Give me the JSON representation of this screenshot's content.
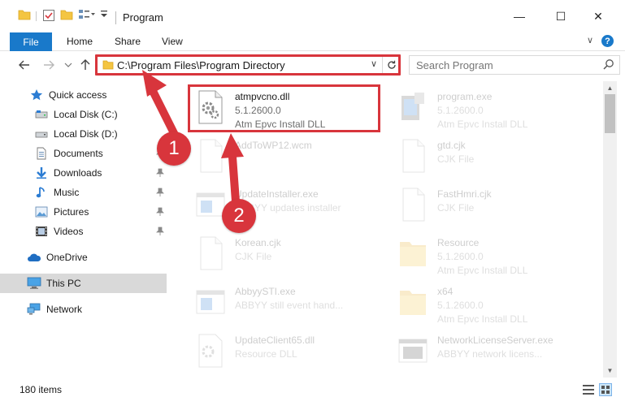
{
  "window": {
    "title": "Program",
    "minimize": "—",
    "maximize": "☐",
    "close": "✕"
  },
  "ribbon": {
    "tabs": [
      "File",
      "Home",
      "Share",
      "View"
    ],
    "collapse": "∨",
    "help": "?"
  },
  "address": {
    "path": "C:\\Program Files\\Program Directory",
    "dropdown": "∨",
    "refresh": "↻"
  },
  "search": {
    "placeholder": "Search Program"
  },
  "nav": {
    "items": [
      {
        "label": "Quick access",
        "icon": "star-icon"
      },
      {
        "label": "Local Disk (C:)",
        "icon": "drive-icon"
      },
      {
        "label": "Local Disk (D:)",
        "icon": "drive-icon"
      },
      {
        "label": "Documents",
        "icon": "documents-icon"
      },
      {
        "label": "Downloads",
        "icon": "download-icon"
      },
      {
        "label": "Music",
        "icon": "music-icon"
      },
      {
        "label": "Pictures",
        "icon": "pictures-icon"
      },
      {
        "label": "Videos",
        "icon": "videos-icon"
      },
      {
        "label": "OneDrive",
        "icon": "cloud-icon"
      },
      {
        "label": "This PC",
        "icon": "computer-icon"
      },
      {
        "label": "Network",
        "icon": "network-icon"
      }
    ]
  },
  "files": [
    {
      "name": "atmpvcno.dll",
      "line1": "5.1.2600.0",
      "line2": "Atm Epvc Install DLL"
    },
    {
      "name": "program.exe",
      "line1": "5.1.2600.0",
      "line2": "Atm Epvc Install DLL"
    },
    {
      "name": "AddToWP12.wcm",
      "line1": "",
      "line2": ""
    },
    {
      "name": "gtd.cjk",
      "line1": "CJK File",
      "line2": ""
    },
    {
      "name": "UpdateInstaller.exe",
      "line1": "ABBYY updates installer",
      "line2": ""
    },
    {
      "name": "FastHmri.cjk",
      "line1": "CJK File",
      "line2": ""
    },
    {
      "name": "Korean.cjk",
      "line1": "CJK File",
      "line2": ""
    },
    {
      "name": "Resource",
      "line1": "5.1.2600.0",
      "line2": "Atm Epvc Install DLL"
    },
    {
      "name": "AbbyySTI.exe",
      "line1": "ABBYY still event hand...",
      "line2": ""
    },
    {
      "name": "x64",
      "line1": "5.1.2600.0",
      "line2": "Atm Epvc Install DLL"
    },
    {
      "name": "UpdateClient65.dll",
      "line1": "Resource DLL",
      "line2": ""
    },
    {
      "name": "NetworkLicenseServer.exe",
      "line1": "ABBYY network licens...",
      "line2": ""
    }
  ],
  "status": {
    "count": "180 items"
  },
  "annotations": {
    "step1": "1",
    "step2": "2",
    "color": "#d8353c"
  }
}
